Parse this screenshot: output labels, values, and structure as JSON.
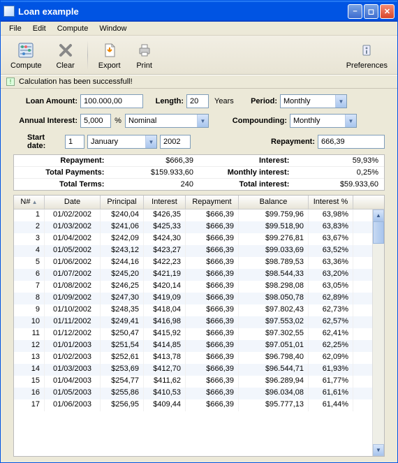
{
  "window": {
    "title": "Loan example"
  },
  "menu": {
    "file": "File",
    "edit": "Edit",
    "compute": "Compute",
    "window": "Window"
  },
  "toolbar": {
    "compute": "Compute",
    "clear": "Clear",
    "export": "Export",
    "print": "Print",
    "prefs": "Preferences"
  },
  "status": {
    "msg": "Calculation has been successfull!"
  },
  "form": {
    "loan_amount_label": "Loan Amount:",
    "loan_amount": "100.000,00",
    "length_label": "Length:",
    "length": "20",
    "length_unit": "Years",
    "period_label": "Period:",
    "period": "Monthly",
    "annual_interest_label": "Annual Interest:",
    "annual_interest": "5,000",
    "pct": "%",
    "interest_type": "Nominal",
    "compounding_label": "Compounding:",
    "compounding": "Monthly",
    "start_date_label": "Start date:",
    "start_day": "1",
    "start_month": "January",
    "start_year": "2002",
    "repayment_label": "Repayment:",
    "repayment": "666,39"
  },
  "summary": {
    "repayment_label": "Repayment:",
    "repayment": "$666,39",
    "interest_label": "Interest:",
    "interest": "59,93%",
    "total_payments_label": "Total Payments:",
    "total_payments": "$159.933,60",
    "monthly_interest_label": "Monthly interest:",
    "monthly_interest": "0,25%",
    "total_terms_label": "Total Terms:",
    "total_terms": "240",
    "total_interest_label": "Total interest:",
    "total_interest": "$59.933,60"
  },
  "table": {
    "headers": {
      "n": "N#",
      "date": "Date",
      "principal": "Principal",
      "interest": "Interest",
      "repayment": "Repayment",
      "balance": "Balance",
      "interest_pct": "Interest %"
    },
    "rows": [
      {
        "n": "1",
        "date": "01/02/2002",
        "pr": "$240,04",
        "int": "$426,35",
        "rep": "$666,39",
        "bal": "$99.759,96",
        "ipct": "63,98%"
      },
      {
        "n": "2",
        "date": "01/03/2002",
        "pr": "$241,06",
        "int": "$425,33",
        "rep": "$666,39",
        "bal": "$99.518,90",
        "ipct": "63,83%"
      },
      {
        "n": "3",
        "date": "01/04/2002",
        "pr": "$242,09",
        "int": "$424,30",
        "rep": "$666,39",
        "bal": "$99.276,81",
        "ipct": "63,67%"
      },
      {
        "n": "4",
        "date": "01/05/2002",
        "pr": "$243,12",
        "int": "$423,27",
        "rep": "$666,39",
        "bal": "$99.033,69",
        "ipct": "63,52%"
      },
      {
        "n": "5",
        "date": "01/06/2002",
        "pr": "$244,16",
        "int": "$422,23",
        "rep": "$666,39",
        "bal": "$98.789,53",
        "ipct": "63,36%"
      },
      {
        "n": "6",
        "date": "01/07/2002",
        "pr": "$245,20",
        "int": "$421,19",
        "rep": "$666,39",
        "bal": "$98.544,33",
        "ipct": "63,20%"
      },
      {
        "n": "7",
        "date": "01/08/2002",
        "pr": "$246,25",
        "int": "$420,14",
        "rep": "$666,39",
        "bal": "$98.298,08",
        "ipct": "63,05%"
      },
      {
        "n": "8",
        "date": "01/09/2002",
        "pr": "$247,30",
        "int": "$419,09",
        "rep": "$666,39",
        "bal": "$98.050,78",
        "ipct": "62,89%"
      },
      {
        "n": "9",
        "date": "01/10/2002",
        "pr": "$248,35",
        "int": "$418,04",
        "rep": "$666,39",
        "bal": "$97.802,43",
        "ipct": "62,73%"
      },
      {
        "n": "10",
        "date": "01/11/2002",
        "pr": "$249,41",
        "int": "$416,98",
        "rep": "$666,39",
        "bal": "$97.553,02",
        "ipct": "62,57%"
      },
      {
        "n": "11",
        "date": "01/12/2002",
        "pr": "$250,47",
        "int": "$415,92",
        "rep": "$666,39",
        "bal": "$97.302,55",
        "ipct": "62,41%"
      },
      {
        "n": "12",
        "date": "01/01/2003",
        "pr": "$251,54",
        "int": "$414,85",
        "rep": "$666,39",
        "bal": "$97.051,01",
        "ipct": "62,25%"
      },
      {
        "n": "13",
        "date": "01/02/2003",
        "pr": "$252,61",
        "int": "$413,78",
        "rep": "$666,39",
        "bal": "$96.798,40",
        "ipct": "62,09%"
      },
      {
        "n": "14",
        "date": "01/03/2003",
        "pr": "$253,69",
        "int": "$412,70",
        "rep": "$666,39",
        "bal": "$96.544,71",
        "ipct": "61,93%"
      },
      {
        "n": "15",
        "date": "01/04/2003",
        "pr": "$254,77",
        "int": "$411,62",
        "rep": "$666,39",
        "bal": "$96.289,94",
        "ipct": "61,77%"
      },
      {
        "n": "16",
        "date": "01/05/2003",
        "pr": "$255,86",
        "int": "$410,53",
        "rep": "$666,39",
        "bal": "$96.034,08",
        "ipct": "61,61%"
      },
      {
        "n": "17",
        "date": "01/06/2003",
        "pr": "$256,95",
        "int": "$409,44",
        "rep": "$666,39",
        "bal": "$95.777,13",
        "ipct": "61,44%"
      }
    ]
  }
}
